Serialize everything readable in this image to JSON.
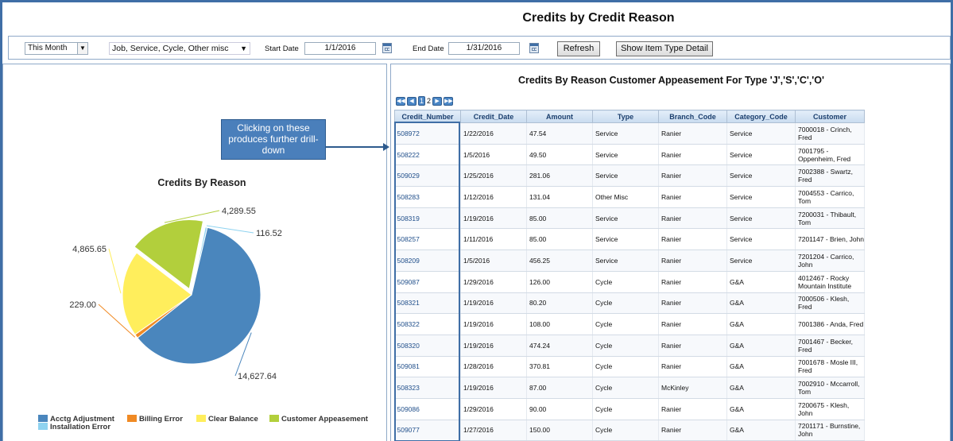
{
  "title": "Credits by Credit Reason",
  "toolbar": {
    "period": "This Month",
    "type_filter": "Job, Service, Cycle, Other misc",
    "start_label": "Start Date",
    "start_date": "1/1/2016",
    "end_label": "End Date",
    "end_date": "1/31/2016",
    "refresh_label": "Refresh",
    "detail_label": "Show Item Type Detail"
  },
  "callout": "Clicking on these produces further drill-down",
  "chart_data": {
    "type": "pie",
    "title": "Credits By Reason",
    "categories": [
      "Acctg Adjustment",
      "Billing Error",
      "Clear Balance",
      "Customer Appeasement",
      "Installation Error"
    ],
    "values": [
      14627.64,
      229.0,
      4865.65,
      4289.55,
      116.52
    ],
    "labels": [
      "14,627.64",
      "229.00",
      "4,865.65",
      "4,289.55",
      "116.52"
    ],
    "colors": [
      "#4a86bd",
      "#f08a24",
      "#ffee5c",
      "#b2cf3c",
      "#8fd3f0"
    ],
    "legend_position": "bottom"
  },
  "table": {
    "title": "Credits By Reason Customer Appeasement For Type 'J','S','C','O'",
    "pager": {
      "current": "1",
      "next": "2"
    },
    "columns": [
      "Credit_Number",
      "Credit_Date",
      "Amount",
      "Type",
      "Branch_Code",
      "Category_Code",
      "Customer"
    ],
    "rows": [
      [
        "508972",
        "1/22/2016",
        "47.54",
        "Service",
        "Ranier",
        "Service",
        "7000018 - Crinch, Fred"
      ],
      [
        "508222",
        "1/5/2016",
        "49.50",
        "Service",
        "Ranier",
        "Service",
        "7001795 - Oppenheim, Fred"
      ],
      [
        "509029",
        "1/25/2016",
        "281.06",
        "Service",
        "Ranier",
        "Service",
        "7002388 - Swartz, Fred"
      ],
      [
        "508283",
        "1/12/2016",
        "131.04",
        "Other Misc",
        "Ranier",
        "Service",
        "7004553 - Carrico, Tom"
      ],
      [
        "508319",
        "1/19/2016",
        "85.00",
        "Service",
        "Ranier",
        "Service",
        "7200031 - Thibault, Tom"
      ],
      [
        "508257",
        "1/11/2016",
        "85.00",
        "Service",
        "Ranier",
        "Service",
        "7201147 - Brien, John"
      ],
      [
        "508209",
        "1/5/2016",
        "456.25",
        "Service",
        "Ranier",
        "Service",
        "7201204 - Carrico, John"
      ],
      [
        "509087",
        "1/29/2016",
        "126.00",
        "Cycle",
        "Ranier",
        "G&A",
        "4012467 - Rocky Mountain Institute"
      ],
      [
        "508321",
        "1/19/2016",
        "80.20",
        "Cycle",
        "Ranier",
        "G&A",
        "7000506 - Klesh, Fred"
      ],
      [
        "508322",
        "1/19/2016",
        "108.00",
        "Cycle",
        "Ranier",
        "G&A",
        "7001386 - Anda, Fred"
      ],
      [
        "508320",
        "1/19/2016",
        "474.24",
        "Cycle",
        "Ranier",
        "G&A",
        "7001467 - Becker, Fred"
      ],
      [
        "509081",
        "1/28/2016",
        "370.81",
        "Cycle",
        "Ranier",
        "G&A",
        "7001678 - Mosle III, Fred"
      ],
      [
        "508323",
        "1/19/2016",
        "87.00",
        "Cycle",
        "McKinley",
        "G&A",
        "7002910 - Mccarroll, Tom"
      ],
      [
        "509086",
        "1/29/2016",
        "90.00",
        "Cycle",
        "Ranier",
        "G&A",
        "7200675 - Klesh, John"
      ],
      [
        "509077",
        "1/27/2016",
        "150.00",
        "Cycle",
        "Ranier",
        "G&A",
        "7201171 - Burnstine, John"
      ]
    ]
  }
}
